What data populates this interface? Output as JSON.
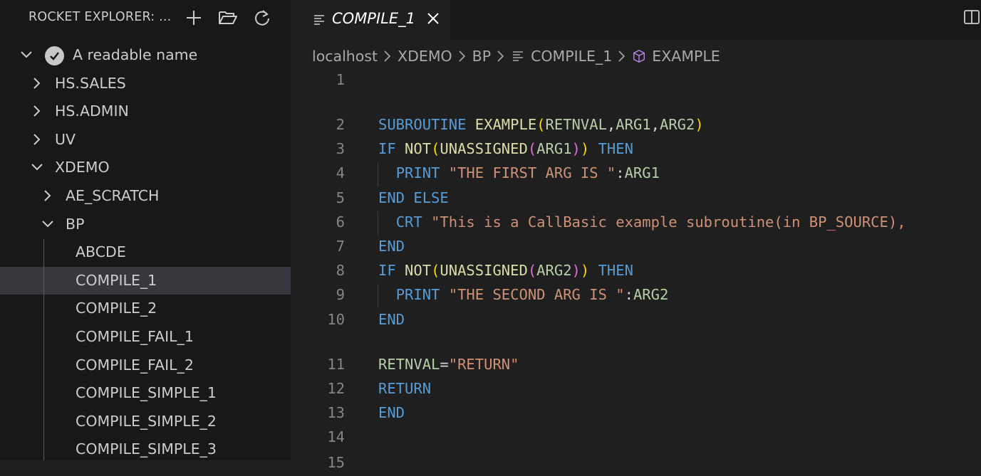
{
  "sidebar": {
    "title": "ROCKET EXPLORER: ...",
    "actions": [
      {
        "icon": "plus-icon"
      },
      {
        "icon": "folder-open-icon"
      },
      {
        "icon": "refresh-icon"
      }
    ],
    "tree": [
      {
        "label": "A readable name",
        "expanded": true,
        "connected": true
      },
      {
        "label": "HS.SALES",
        "expanded": false
      },
      {
        "label": "HS.ADMIN",
        "expanded": false
      },
      {
        "label": "UV",
        "expanded": false
      },
      {
        "label": "XDEMO",
        "expanded": true
      },
      {
        "label": "AE_SCRATCH",
        "expanded": false
      },
      {
        "label": "BP",
        "expanded": true
      },
      {
        "label": "ABCDE"
      },
      {
        "label": "COMPILE_1",
        "selected": true
      },
      {
        "label": "COMPILE_2"
      },
      {
        "label": "COMPILE_FAIL_1"
      },
      {
        "label": "COMPILE_FAIL_2"
      },
      {
        "label": "COMPILE_SIMPLE_1"
      },
      {
        "label": "COMPILE_SIMPLE_2"
      },
      {
        "label": "COMPILE_SIMPLE_3"
      }
    ]
  },
  "editor": {
    "tab": {
      "label": "COMPILE_1",
      "icon": "file-lines-icon"
    },
    "breadcrumb": [
      "localhost",
      "XDEMO",
      "BP",
      "COMPILE_1",
      "EXAMPLE"
    ],
    "lines": [
      {
        "num": "1",
        "text": ""
      },
      {
        "num": "2",
        "text": "SUBROUTINE EXAMPLE(RETNVAL,ARG1,ARG2)"
      },
      {
        "num": "3",
        "text": "IF NOT(UNASSIGNED(ARG1)) THEN"
      },
      {
        "num": "4",
        "text": "  PRINT \"THE FIRST ARG IS \":ARG1"
      },
      {
        "num": "5",
        "text": "END ELSE"
      },
      {
        "num": "6",
        "text": "  CRT \"This is a CallBasic example subroutine(in BP_SOURCE),"
      },
      {
        "num": "7",
        "text": "END"
      },
      {
        "num": "8",
        "text": "IF NOT(UNASSIGNED(ARG2)) THEN"
      },
      {
        "num": "9",
        "text": "  PRINT \"THE SECOND ARG IS \":ARG2"
      },
      {
        "num": "10",
        "text": "END"
      },
      {
        "num": "11",
        "text": "RETNVAL=\"RETURN\""
      },
      {
        "num": "12",
        "text": "RETURN"
      },
      {
        "num": "13",
        "text": "END"
      },
      {
        "num": "14",
        "text": ""
      },
      {
        "num": "15",
        "text": ""
      }
    ]
  },
  "colors": {
    "keyword": "#569cd6",
    "string": "#ce9178",
    "variable": "#b5cea8",
    "function": "#dcdcaa",
    "bracket1": "#ffd700",
    "bracket2": "#da70d6",
    "selection": "#37373d",
    "sidebar_bg": "#181818",
    "editor_bg": "#1f1f1f"
  }
}
